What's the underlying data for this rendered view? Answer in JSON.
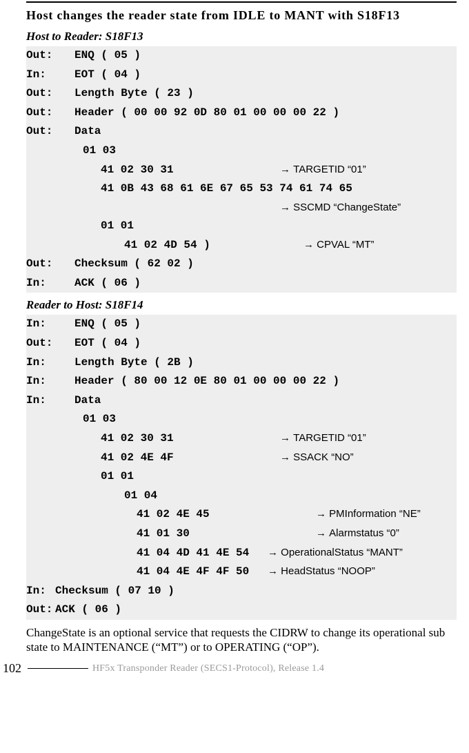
{
  "heading": "Host changes the reader state from IDLE to MANT with S18F13",
  "section1": {
    "title": "Host to Reader: S18F13",
    "rows": [
      {
        "dir": "Out:",
        "hex": "ENQ ( 05 )"
      },
      {
        "dir": "In:",
        "hex": "EOT ( 04 )"
      },
      {
        "dir": "Out:",
        "hex": "Length Byte ( 23 )"
      },
      {
        "dir": "Out:",
        "hex": "Header ( 00 00 92 0D 80 01 00 00 00 22 )"
      },
      {
        "dir": "Out:",
        "hex": "Data"
      },
      {
        "dir": "",
        "hex": "01 03",
        "indent": 1
      },
      {
        "dir": "",
        "hex": "41 02 30 31",
        "indent": 2,
        "mid": true,
        "ann": "TARGETID “01”"
      },
      {
        "dir": "",
        "hex": "41 0B 43 68 61 6E 67 65 53 74 61 74 65",
        "indent": 2
      },
      {
        "dir": "",
        "hex": "",
        "indent": 2,
        "mid": true,
        "ann": "SSCMD “ChangeState”"
      },
      {
        "dir": "",
        "hex": "01 01",
        "indent": 2
      },
      {
        "dir": "",
        "hex": "41 02 4D 54 )",
        "indent": 3,
        "mid": true,
        "ann": "CPVAL “MT”"
      },
      {
        "dir": "Out:",
        "hex": "Checksum ( 62 02 )"
      },
      {
        "dir": "In:",
        "hex": "ACK ( 06 )"
      }
    ]
  },
  "section2": {
    "title": "Reader to Host: S18F14",
    "rows": [
      {
        "dir": "In:",
        "hex": "ENQ ( 05 )"
      },
      {
        "dir": "Out:",
        "hex": "EOT ( 04 )"
      },
      {
        "dir": "In:",
        "hex": "Length Byte ( 2B )"
      },
      {
        "dir": "In:",
        "hex": "Header ( 80 00 12 0E 80 01 00 00 00 22 )"
      },
      {
        "dir": "In:",
        "hex": "Data"
      },
      {
        "dir": "",
        "hex": "01 03",
        "indent": 1
      },
      {
        "dir": "",
        "hex": "41 02 30 31",
        "indent": 2,
        "mid": true,
        "ann": "TARGETID “01”"
      },
      {
        "dir": "",
        "hex": "41 02 4E 4F",
        "indent": 2,
        "mid": true,
        "ann": "SSACK “NO”"
      },
      {
        "dir": "",
        "hex": "01 01",
        "indent": 2
      },
      {
        "dir": "",
        "hex": "01 04",
        "indent": 3
      },
      {
        "dir": "",
        "hex": "41 02 4E 45",
        "indent": 4,
        "mid": true,
        "ann": "PMInformation “NE”"
      },
      {
        "dir": "",
        "hex": "41 01 30",
        "indent": 4,
        "mid": true,
        "ann": "Alarmstatus “0”",
        "bigq": true
      },
      {
        "dir": "",
        "hex": "41 04 4D 41 4E 54",
        "indent": 4,
        "mid": true,
        "midwide": 190,
        "ann": "OperationalStatus “MANT”"
      },
      {
        "dir": "",
        "hex": "41 04 4E 4F 4F 50",
        "indent": 4,
        "mid": true,
        "midwide": 190,
        "ann": "HeadStatus “NOOP”"
      },
      {
        "dir": "In:",
        "hex": "Checksum ( 07 10 )",
        "tight": true
      },
      {
        "dir": "Out:",
        "hex": "ACK ( 06 )",
        "tight": true
      }
    ]
  },
  "paragraph": "ChangeState is an optional service that requests the CIDRW to change its operational sub state to MAINTENANCE (“MT”) or to OPERATING (“OP”).",
  "footer": {
    "page": "102",
    "doc": "HF5x Transponder Reader (SECS1-Protocol), Release 1.4"
  },
  "arrow": "→"
}
